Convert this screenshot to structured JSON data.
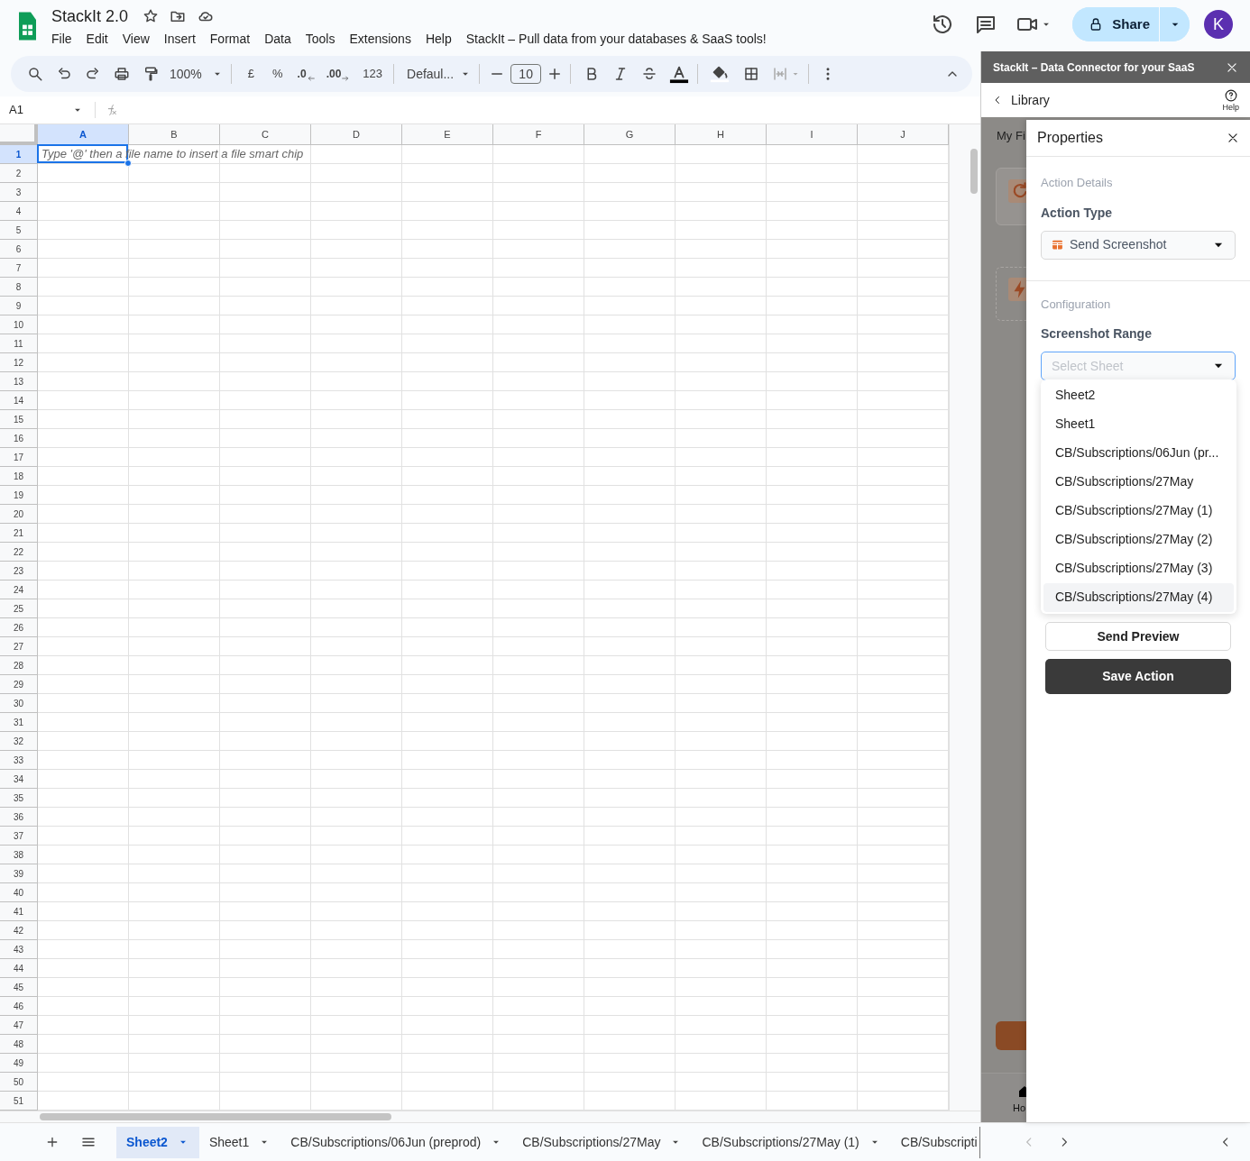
{
  "document": {
    "title": "StackIt 2.0",
    "menu": [
      "File",
      "Edit",
      "View",
      "Insert",
      "Format",
      "Data",
      "Tools",
      "Extensions",
      "Help",
      "StackIt – Pull data from your databases & SaaS tools!"
    ]
  },
  "share": {
    "label": "Share"
  },
  "avatar": {
    "initial": "K"
  },
  "toolbar": {
    "zoom": "100%",
    "currency": "£",
    "percent": "%",
    "decrease_decimals": ".0",
    "increase_decimals": ".00",
    "number_format": "123",
    "font": "Defaul...",
    "font_size": "10"
  },
  "formula_bar": {
    "cell_ref": "A1"
  },
  "grid": {
    "columns": [
      {
        "label": "A",
        "selected": true
      },
      {
        "label": "B",
        "selected": false
      },
      {
        "label": "C",
        "selected": false
      },
      {
        "label": "D",
        "selected": false
      },
      {
        "label": "E",
        "selected": false
      },
      {
        "label": "F",
        "selected": false
      },
      {
        "label": "G",
        "selected": false
      },
      {
        "label": "H",
        "selected": false
      },
      {
        "label": "I",
        "selected": false
      },
      {
        "label": "J",
        "selected": false
      }
    ],
    "rows": [
      {
        "label": "1",
        "selected": true
      },
      {
        "label": "2",
        "selected": false
      },
      {
        "label": "3",
        "selected": false
      },
      {
        "label": "4",
        "selected": false
      },
      {
        "label": "5",
        "selected": false
      },
      {
        "label": "6",
        "selected": false
      },
      {
        "label": "7",
        "selected": false
      },
      {
        "label": "8",
        "selected": false
      },
      {
        "label": "9",
        "selected": false
      },
      {
        "label": "10",
        "selected": false
      },
      {
        "label": "11",
        "selected": false
      },
      {
        "label": "12",
        "selected": false
      },
      {
        "label": "13",
        "selected": false
      },
      {
        "label": "14",
        "selected": false
      },
      {
        "label": "15",
        "selected": false
      },
      {
        "label": "16",
        "selected": false
      },
      {
        "label": "17",
        "selected": false
      },
      {
        "label": "18",
        "selected": false
      },
      {
        "label": "19",
        "selected": false
      },
      {
        "label": "20",
        "selected": false
      },
      {
        "label": "21",
        "selected": false
      },
      {
        "label": "22",
        "selected": false
      },
      {
        "label": "23",
        "selected": false
      },
      {
        "label": "24",
        "selected": false
      },
      {
        "label": "25",
        "selected": false
      },
      {
        "label": "26",
        "selected": false
      },
      {
        "label": "27",
        "selected": false
      },
      {
        "label": "28",
        "selected": false
      },
      {
        "label": "29",
        "selected": false
      },
      {
        "label": "30",
        "selected": false
      },
      {
        "label": "31",
        "selected": false
      },
      {
        "label": "32",
        "selected": false
      },
      {
        "label": "33",
        "selected": false
      },
      {
        "label": "34",
        "selected": false
      },
      {
        "label": "35",
        "selected": false
      },
      {
        "label": "36",
        "selected": false
      },
      {
        "label": "37",
        "selected": false
      },
      {
        "label": "38",
        "selected": false
      },
      {
        "label": "39",
        "selected": false
      },
      {
        "label": "40",
        "selected": false
      },
      {
        "label": "41",
        "selected": false
      },
      {
        "label": "42",
        "selected": false
      },
      {
        "label": "43",
        "selected": false
      },
      {
        "label": "44",
        "selected": false
      },
      {
        "label": "45",
        "selected": false
      },
      {
        "label": "46",
        "selected": false
      },
      {
        "label": "47",
        "selected": false
      },
      {
        "label": "48",
        "selected": false
      },
      {
        "label": "49",
        "selected": false
      },
      {
        "label": "50",
        "selected": false
      },
      {
        "label": "51",
        "selected": false
      }
    ],
    "active_cell_placeholder": "Type '@' then a file name to insert a file smart chip"
  },
  "side_panel": {
    "title": "StackIt – Data Connector for your SaaS",
    "back_label": "Library",
    "help_label": "Help",
    "background_tab": "My Fi",
    "background_nav": "Ho"
  },
  "properties": {
    "title": "Properties",
    "section_1": "Action Details",
    "action_type_label": "Action Type",
    "action_type_value": "Send Screenshot",
    "section_2": "Configuration",
    "range_label": "Screenshot Range",
    "range_placeholder": "Select Sheet",
    "options": [
      {
        "label": "Sheet2",
        "highlighted": false
      },
      {
        "label": "Sheet1",
        "highlighted": false
      },
      {
        "label": "CB/Subscriptions/06Jun (pr...",
        "highlighted": false
      },
      {
        "label": "CB/Subscriptions/27May",
        "highlighted": false
      },
      {
        "label": "CB/Subscriptions/27May (1)",
        "highlighted": false
      },
      {
        "label": "CB/Subscriptions/27May (2)",
        "highlighted": false
      },
      {
        "label": "CB/Subscriptions/27May (3)",
        "highlighted": false
      },
      {
        "label": "CB/Subscriptions/27May (4)",
        "highlighted": true
      }
    ],
    "preview_button": "Send Preview",
    "save_button": "Save Action"
  },
  "sheet_tabs": [
    {
      "label": "Sheet2",
      "selected": true
    },
    {
      "label": "Sheet1",
      "selected": false
    },
    {
      "label": "CB/Subscriptions/06Jun (preprod)",
      "selected": false
    },
    {
      "label": "CB/Subscriptions/27May",
      "selected": false
    },
    {
      "label": "CB/Subscriptions/27May (1)",
      "selected": false
    },
    {
      "label": "CB/Subscripti",
      "selected": false
    }
  ]
}
